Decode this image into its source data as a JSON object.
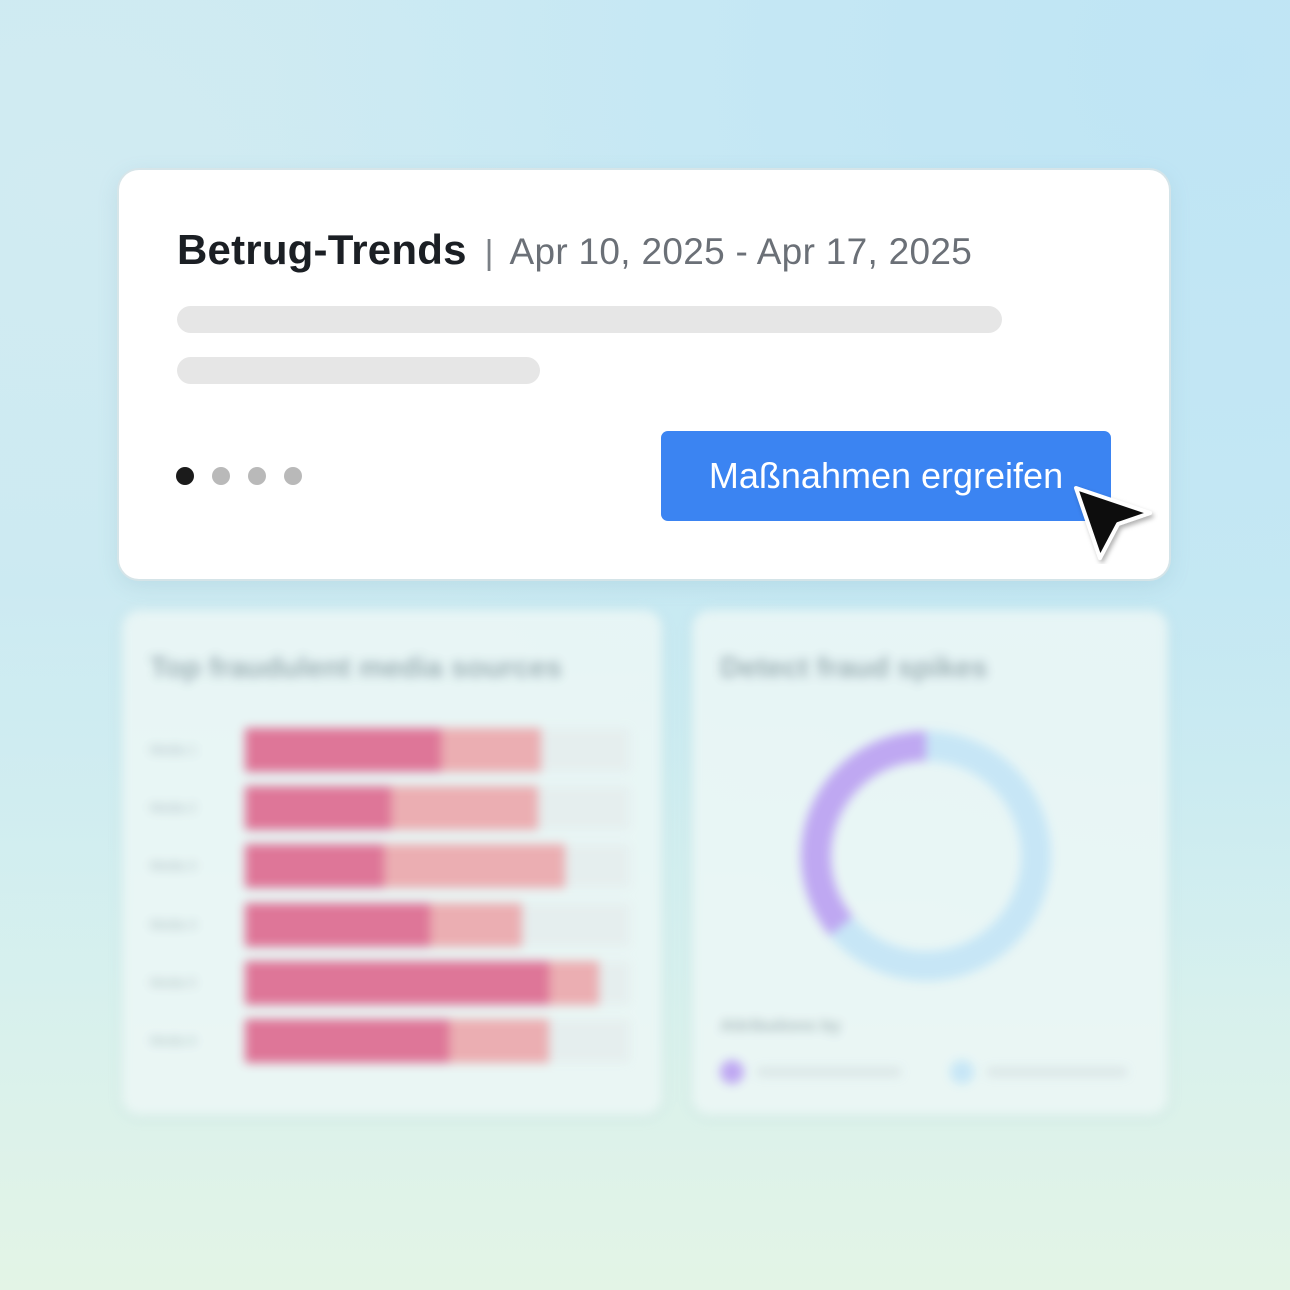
{
  "card": {
    "title": "Betrug-Trends",
    "separator": "|",
    "date_range": "Apr 10, 2025 - Apr 17, 2025",
    "pager": {
      "total": 4,
      "active_index": 0
    },
    "action_button_label": "Maßnahmen ergreifen"
  },
  "left_panel": {
    "title": "Top fraudulent media sources",
    "chart_data": {
      "type": "bar",
      "stacked": true,
      "orientation": "horizontal",
      "categories": [
        "Media 1",
        "Media 2",
        "Media 3",
        "Media 4",
        "Media 5",
        "Media 6"
      ],
      "series": [
        {
          "values": [
            0.51,
            0.38,
            0.36,
            0.48,
            0.79,
            0.53
          ]
        },
        {
          "values": [
            0.26,
            0.38,
            0.47,
            0.24,
            0.13,
            0.26
          ]
        }
      ],
      "colors": [
        "#de7698",
        "#ebaeb2"
      ],
      "track_color": "#e5eeee"
    }
  },
  "right_panel": {
    "title": "Detect fraud spikes",
    "chart_data": {
      "type": "pie",
      "donut": true,
      "values": [
        0.36,
        0.64
      ],
      "colors": [
        "#bfa8f2",
        "#c7e6f6"
      ]
    },
    "legend_title": "Attributions by",
    "legend_colors": [
      "#bfa8f2",
      "#c7e6f6"
    ]
  }
}
